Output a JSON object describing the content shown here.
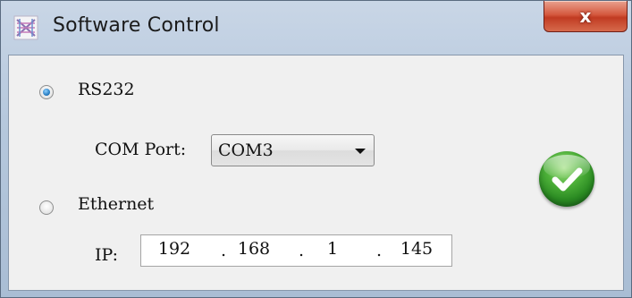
{
  "window": {
    "title": "Software Control",
    "close_label": "x"
  },
  "connection": {
    "rs232_label": "RS232",
    "rs232_selected": true,
    "com_port_label": "COM Port:",
    "com_port_value": "COM3",
    "ethernet_label": "Ethernet",
    "ethernet_selected": false,
    "ip_label": "IP:",
    "ip": [
      "192",
      "168",
      "1",
      "145"
    ],
    "ip_separator": "."
  },
  "icons": {
    "app": "app-logo-icon",
    "close": "close-icon",
    "ok": "checkmark-icon"
  },
  "colors": {
    "ok_button": "#2a8a22",
    "close_button": "#c13b22",
    "radio_selected": "#2a7fc4"
  }
}
